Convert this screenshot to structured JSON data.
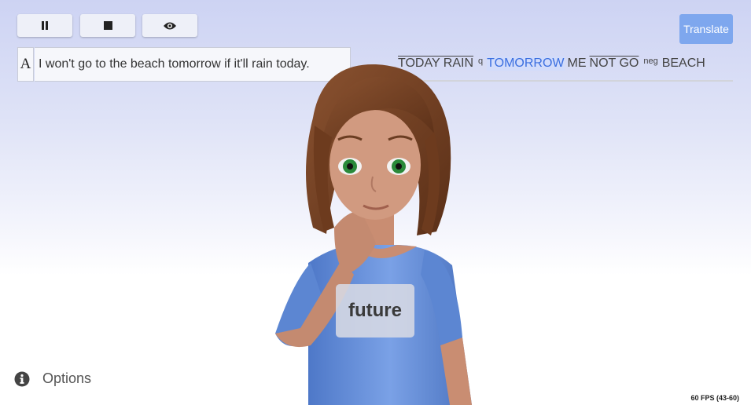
{
  "controls": {
    "pause_icon": "pause-icon",
    "stop_icon": "stop-icon",
    "eye_icon": "eye-icon"
  },
  "input": {
    "font_toggle_label": "A",
    "value": "I won't go to the beach tomorrow if it'll rain today."
  },
  "translate_label": "Translate",
  "gloss": {
    "tokens": [
      {
        "text": "TODAY RAIN",
        "overline": true,
        "sup": "q",
        "highlight": false
      },
      {
        "text": "TOMORROW",
        "overline": false,
        "sup": "",
        "highlight": true
      },
      {
        "text": "ME",
        "overline": false,
        "sup": "",
        "highlight": false
      },
      {
        "text": "NOT GO",
        "overline": true,
        "sup": "neg",
        "highlight": false
      },
      {
        "text": "BEACH",
        "overline": false,
        "sup": "",
        "highlight": false
      }
    ]
  },
  "caption": "future",
  "options_label": "Options",
  "fps_label": "60 FPS (43-60)",
  "colors": {
    "accent": "#7ea7ee",
    "highlight": "#3b6fe0"
  }
}
